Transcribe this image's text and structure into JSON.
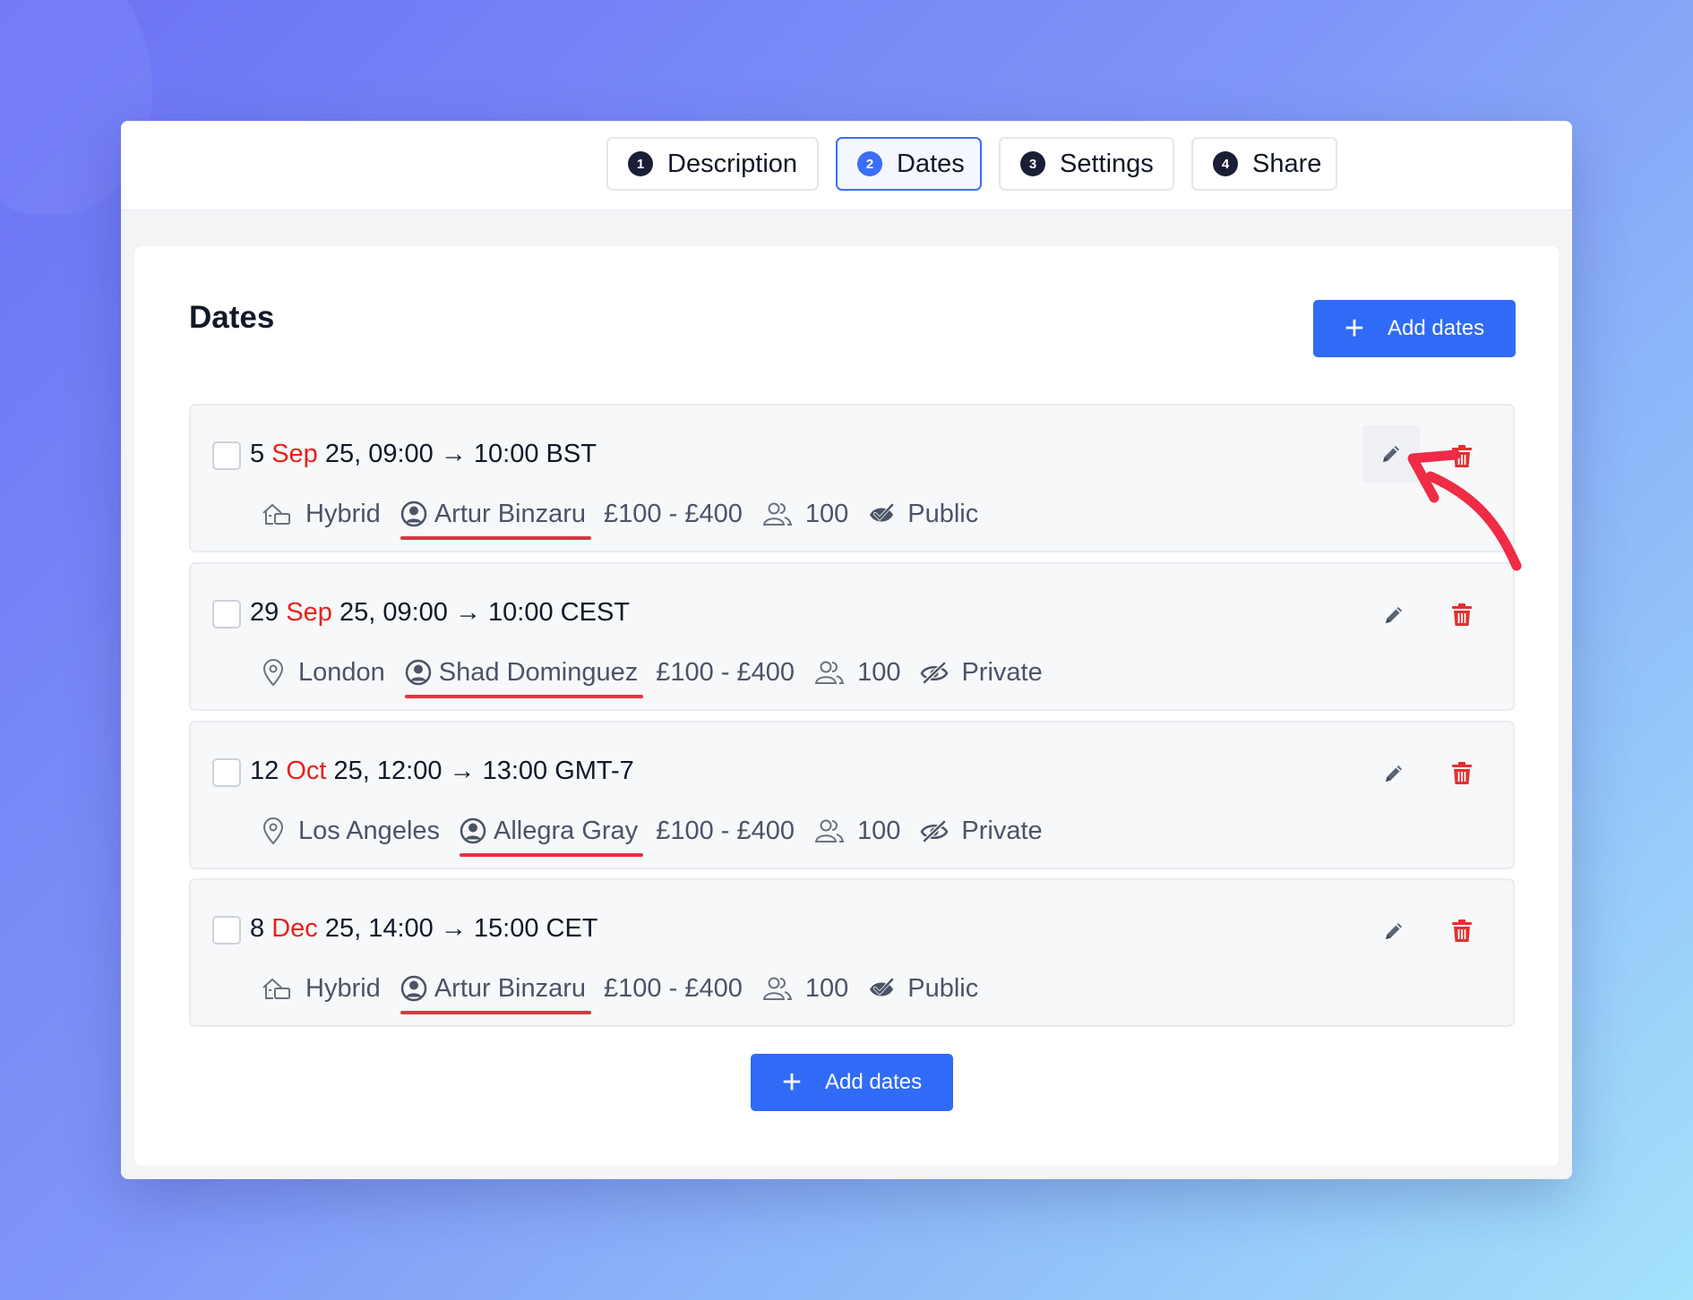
{
  "tabs": [
    {
      "num": "1",
      "label": "Description"
    },
    {
      "num": "2",
      "label": "Dates"
    },
    {
      "num": "3",
      "label": "Settings"
    },
    {
      "num": "4",
      "label": "Share"
    }
  ],
  "active_tab": "Dates",
  "section_title": "Dates",
  "add_dates_label": "Add dates",
  "colors": {
    "accent": "#2f6bf6",
    "month": "#e8211b",
    "delete": "#e03131",
    "underline": "#e8303f"
  },
  "dates": [
    {
      "day": "5",
      "month": "Sep",
      "rest": " 25, 09:00 → 10:00 BST",
      "location_icon": "hybrid-icon",
      "location": "Hybrid",
      "host": "Artur Binzaru",
      "price": "£100 - £400",
      "capacity": "100",
      "visibility_icon": "public-icon",
      "visibility": "Public"
    },
    {
      "day": "29",
      "month": "Sep",
      "rest": " 25, 09:00 → 10:00 CEST",
      "location_icon": "location-pin-icon",
      "location": "London",
      "host": "Shad Dominguez",
      "price": "£100 - £400",
      "capacity": "100",
      "visibility_icon": "private-icon",
      "visibility": "Private"
    },
    {
      "day": "12",
      "month": "Oct",
      "rest": " 25, 12:00 → 13:00 GMT-7",
      "location_icon": "location-pin-icon",
      "location": "Los Angeles",
      "host": "Allegra Gray",
      "price": "£100 - £400",
      "capacity": "100",
      "visibility_icon": "private-icon",
      "visibility": "Private"
    },
    {
      "day": "8",
      "month": "Dec",
      "rest": " 25, 14:00 → 15:00 CET",
      "location_icon": "hybrid-icon",
      "location": "Hybrid",
      "host": "Artur Binzaru",
      "price": "£100 - £400",
      "capacity": "100",
      "visibility_icon": "public-icon",
      "visibility": "Public"
    }
  ]
}
